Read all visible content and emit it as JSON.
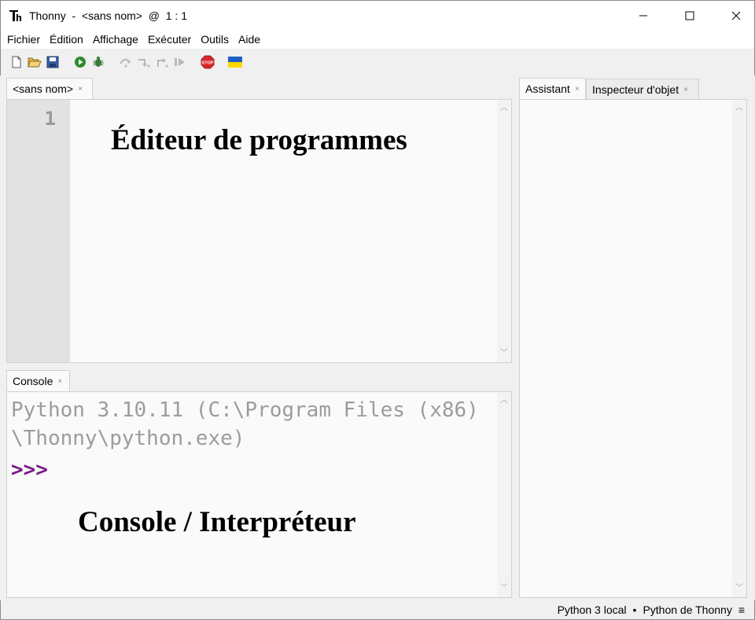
{
  "window": {
    "title": "Thonny  -  <sans nom>  @  1 : 1",
    "app_icon": "thonny-logo-icon",
    "controls": [
      "minimize-icon",
      "maximize-icon",
      "close-icon"
    ]
  },
  "menu": [
    "Fichier",
    "Édition",
    "Affichage",
    "Exécuter",
    "Outils",
    "Aide"
  ],
  "toolbar": {
    "icons": [
      "new-file-icon",
      "open-file-icon",
      "save-icon",
      "run-icon",
      "debug-icon",
      "step-over-icon",
      "step-into-icon",
      "step-out-icon",
      "resume-icon",
      "stop-icon",
      "ukraine-flag-icon"
    ],
    "stop_text": "STOP"
  },
  "editor": {
    "tab_label": "<sans nom>",
    "tab_close": "×",
    "line_number": "1",
    "annotation": "Éditeur de programmes"
  },
  "console": {
    "tab_label": "Console",
    "tab_close": "×",
    "lines": [
      "Python 3.10.11 (C:\\Program Files (x86)",
      "\\Thonny\\python.exe)"
    ],
    "prompt": ">>>",
    "annotation": "Console / Interpréteur"
  },
  "side_panel": {
    "tabs": [
      {
        "label": "Assistant",
        "close": "×"
      },
      {
        "label": "Inspecteur d'objet",
        "close": "×"
      }
    ]
  },
  "status": {
    "interpreter": "Python 3 local",
    "separator": "•",
    "env": "Python de Thonny",
    "menu_glyph": "≡"
  },
  "colors": {
    "prompt": "#781b86",
    "console_text": "#9c9c9c",
    "gutter": "#e2e2e2",
    "editor_bg": "#fafafa",
    "run_green": "#2e8b2e",
    "stop_red": "#d9262a"
  }
}
